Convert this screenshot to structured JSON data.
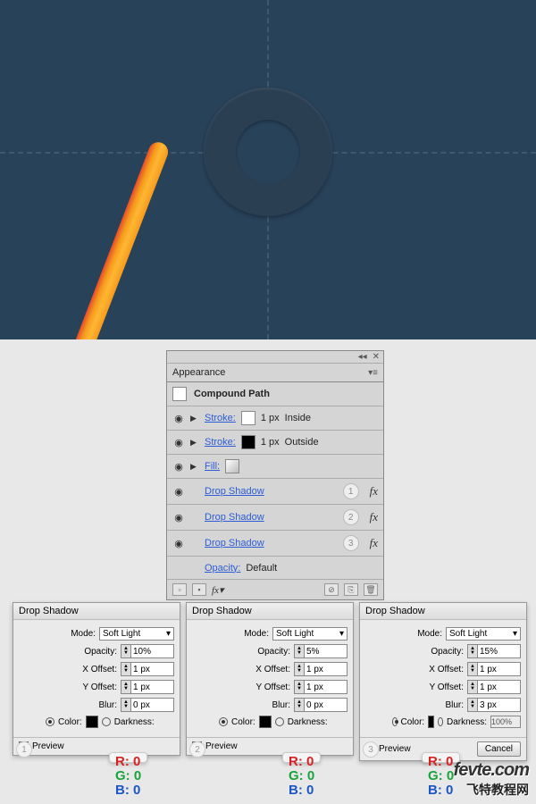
{
  "appearance": {
    "title": "Appearance",
    "object_type": "Compound Path",
    "rows": [
      {
        "label": "Stroke:",
        "value": "1 px",
        "align": "Inside",
        "swatch": "white"
      },
      {
        "label": "Stroke:",
        "value": "1 px",
        "align": "Outside",
        "swatch": "black"
      },
      {
        "label": "Fill:",
        "value": "",
        "align": "",
        "swatch": "grad"
      }
    ],
    "effects": [
      {
        "label": "Drop Shadow",
        "num": "1"
      },
      {
        "label": "Drop Shadow",
        "num": "2"
      },
      {
        "label": "Drop Shadow",
        "num": "3"
      }
    ],
    "opacity_label": "Opacity:",
    "opacity_value": "Default",
    "fx_label": "fx"
  },
  "dialogs": [
    {
      "title": "Drop Shadow",
      "mode_label": "Mode:",
      "mode": "Soft Light",
      "opacity_label": "Opacity:",
      "opacity": "10%",
      "xoff_label": "X Offset:",
      "xoff": "1 px",
      "yoff_label": "Y Offset:",
      "yoff": "1 px",
      "blur_label": "Blur:",
      "blur": "0 px",
      "color_label": "Color:",
      "darkness_label": "Darkness:",
      "preview_label": "Preview",
      "num": "1",
      "rgb": {
        "r": "R: 0",
        "g": "G: 0",
        "b": "B: 0"
      }
    },
    {
      "title": "Drop Shadow",
      "mode_label": "Mode:",
      "mode": "Soft Light",
      "opacity_label": "Opacity:",
      "opacity": "5%",
      "xoff_label": "X Offset:",
      "xoff": "1 px",
      "yoff_label": "Y Offset:",
      "yoff": "1 px",
      "blur_label": "Blur:",
      "blur": "0 px",
      "color_label": "Color:",
      "darkness_label": "Darkness:",
      "preview_label": "Preview",
      "num": "2",
      "rgb": {
        "r": "R: 0",
        "g": "G: 0",
        "b": "B: 0"
      }
    },
    {
      "title": "Drop Shadow",
      "mode_label": "Mode:",
      "mode": "Soft Light",
      "opacity_label": "Opacity:",
      "opacity": "15%",
      "xoff_label": "X Offset:",
      "xoff": "1 px",
      "yoff_label": "Y Offset:",
      "yoff": "1 px",
      "blur_label": "Blur:",
      "blur": "3 px",
      "color_label": "Color:",
      "darkness_label": "Darkness:",
      "darkness_value": "100%",
      "preview_label": "Preview",
      "cancel": "Cancel",
      "num": "3",
      "rgb": {
        "r": "R: 0",
        "g": "G: 0",
        "b": "B: 0"
      }
    }
  ],
  "watermark": {
    "line1": "fevte.com",
    "line2": "飞特教程网"
  }
}
